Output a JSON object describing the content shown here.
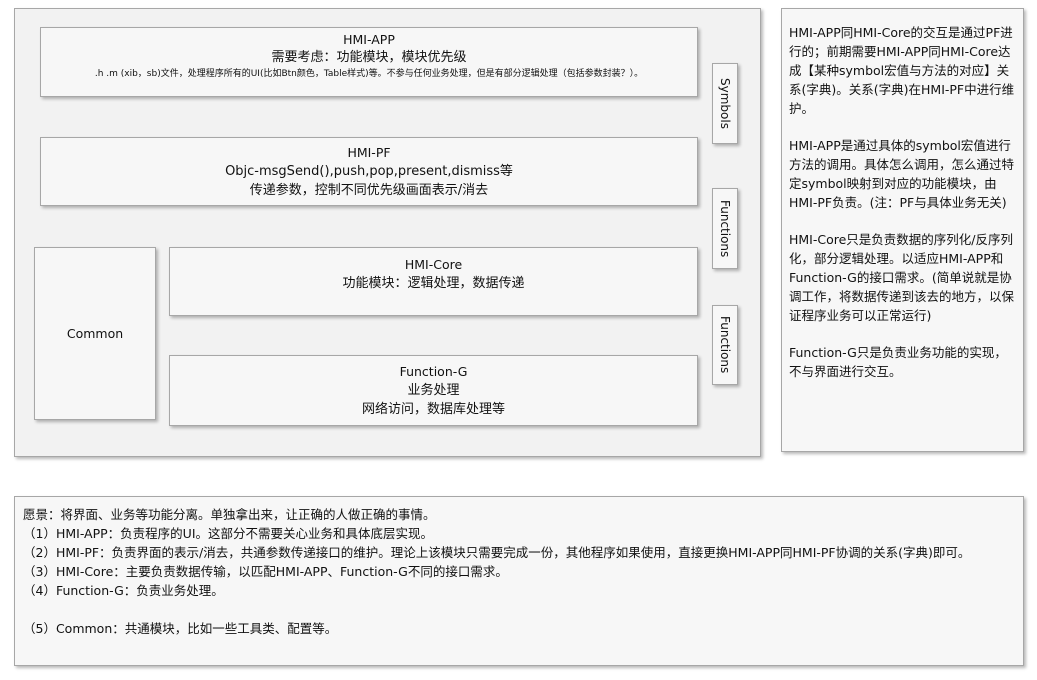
{
  "diagram": {
    "hmi_app": {
      "title": "HMI-APP",
      "subtitle": "需要考虑：功能模块，模块优先级",
      "detail": ".h .m (xib，sb)文件，处理程序所有的UI(比如Btn颜色，Table样式)等。不参与任何业务处理，但是有部分逻辑处理（包括参数封装？）。"
    },
    "hmi_pf": {
      "title": "HMI-PF",
      "line1": "Objc-msgSend(),push,pop,present,dismiss等",
      "line2": "传递参数，控制不同优先级画面表示/消去"
    },
    "common": {
      "title": "Common"
    },
    "hmi_core": {
      "title": "HMI-Core",
      "line1": "功能模块：逻辑处理，数据传递"
    },
    "function_g": {
      "title": "Function-G",
      "line1": "业务处理",
      "line2": "网络访问，数据库处理等"
    },
    "tabs": {
      "symbols": "Symbols",
      "functions_1": "Functions",
      "functions_2": "Functions"
    }
  },
  "notes": {
    "p1": "HMI-APP同HMI-Core的交互是通过PF进行的；前期需要HMI-APP同HMI-Core达成【某种symbol宏值与方法的对应】关系(字典)。关系(字典)在HMI-PF中进行维护。",
    "p2": "HMI-APP是通过具体的symbol宏值进行方法的调用。具体怎么调用，怎么通过特定symbol映射到对应的功能模块，由HMI-PF负责。(注：PF与具体业务无关)",
    "p3": "HMI-Core只是负责数据的序列化/反序列化，部分逻辑处理。以适应HMI-APP和Function-G的接口需求。(简单说就是协调工作，将数据传递到该去的地方，以保证程序业务可以正常运行)",
    "p4": "Function-G只是负责业务功能的实现，不与界面进行交互。"
  },
  "summary": {
    "intro": "愿景：将界面、业务等功能分离。单独拿出来，让正确的人做正确的事情。",
    "item1": "（1）HMI-APP：负责程序的UI。这部分不需要关心业务和具体底层实现。",
    "item2": "（2）HMI-PF：负责界面的表示/消去，共通参数传递接口的维护。理论上该模块只需要完成一份，其他程序如果使用，直接更换HMI-APP同HMI-PF协调的关系(字典)即可。",
    "item3": "（3）HMI-Core：主要负责数据传输，以匹配HMI-APP、Function-G不同的接口需求。",
    "item4": "（4）Function-G：负责业务处理。",
    "item5": "（5）Common：共通模块，比如一些工具类、配置等。"
  }
}
